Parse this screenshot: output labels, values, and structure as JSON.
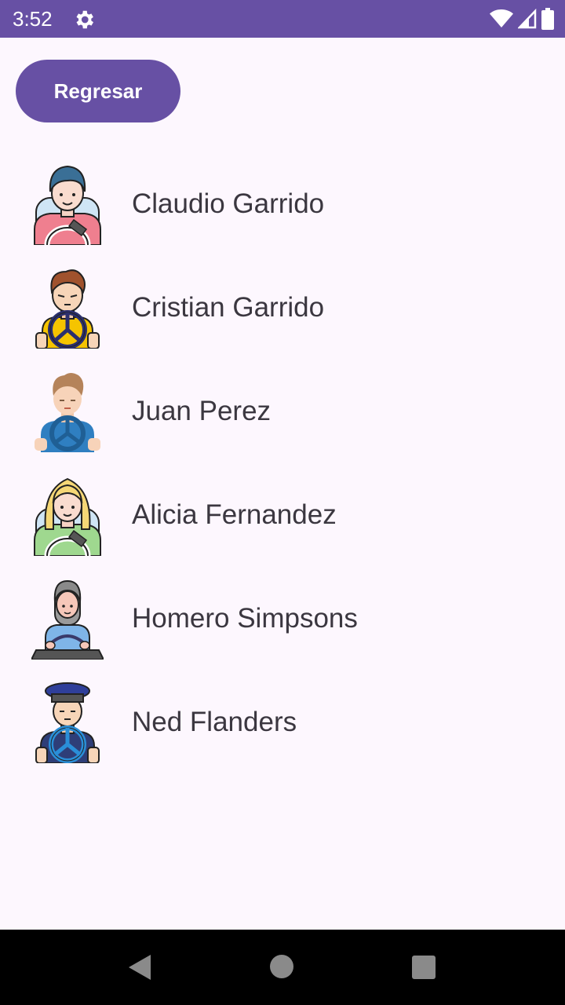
{
  "status_bar": {
    "time": "3:52",
    "icons": [
      "gear-icon",
      "wifi-icon",
      "signal-icon",
      "battery-icon"
    ]
  },
  "back_button": {
    "label": "Regresar"
  },
  "drivers": [
    {
      "name": "Claudio Garrido",
      "avatar": "driver-avatar-blue-hair-icon"
    },
    {
      "name": "Cristian Garrido",
      "avatar": "driver-avatar-brown-hair-icon"
    },
    {
      "name": "Juan Perez",
      "avatar": "driver-avatar-light-brown-hair-icon"
    },
    {
      "name": "Alicia Fernandez",
      "avatar": "driver-avatar-blonde-woman-icon"
    },
    {
      "name": "Homero Simpsons",
      "avatar": "driver-avatar-gray-hair-icon"
    },
    {
      "name": "Ned Flanders",
      "avatar": "driver-avatar-cap-icon"
    }
  ],
  "colors": {
    "accent": "#6750A4",
    "background": "#FDF7FE",
    "text": "#3B3740"
  }
}
